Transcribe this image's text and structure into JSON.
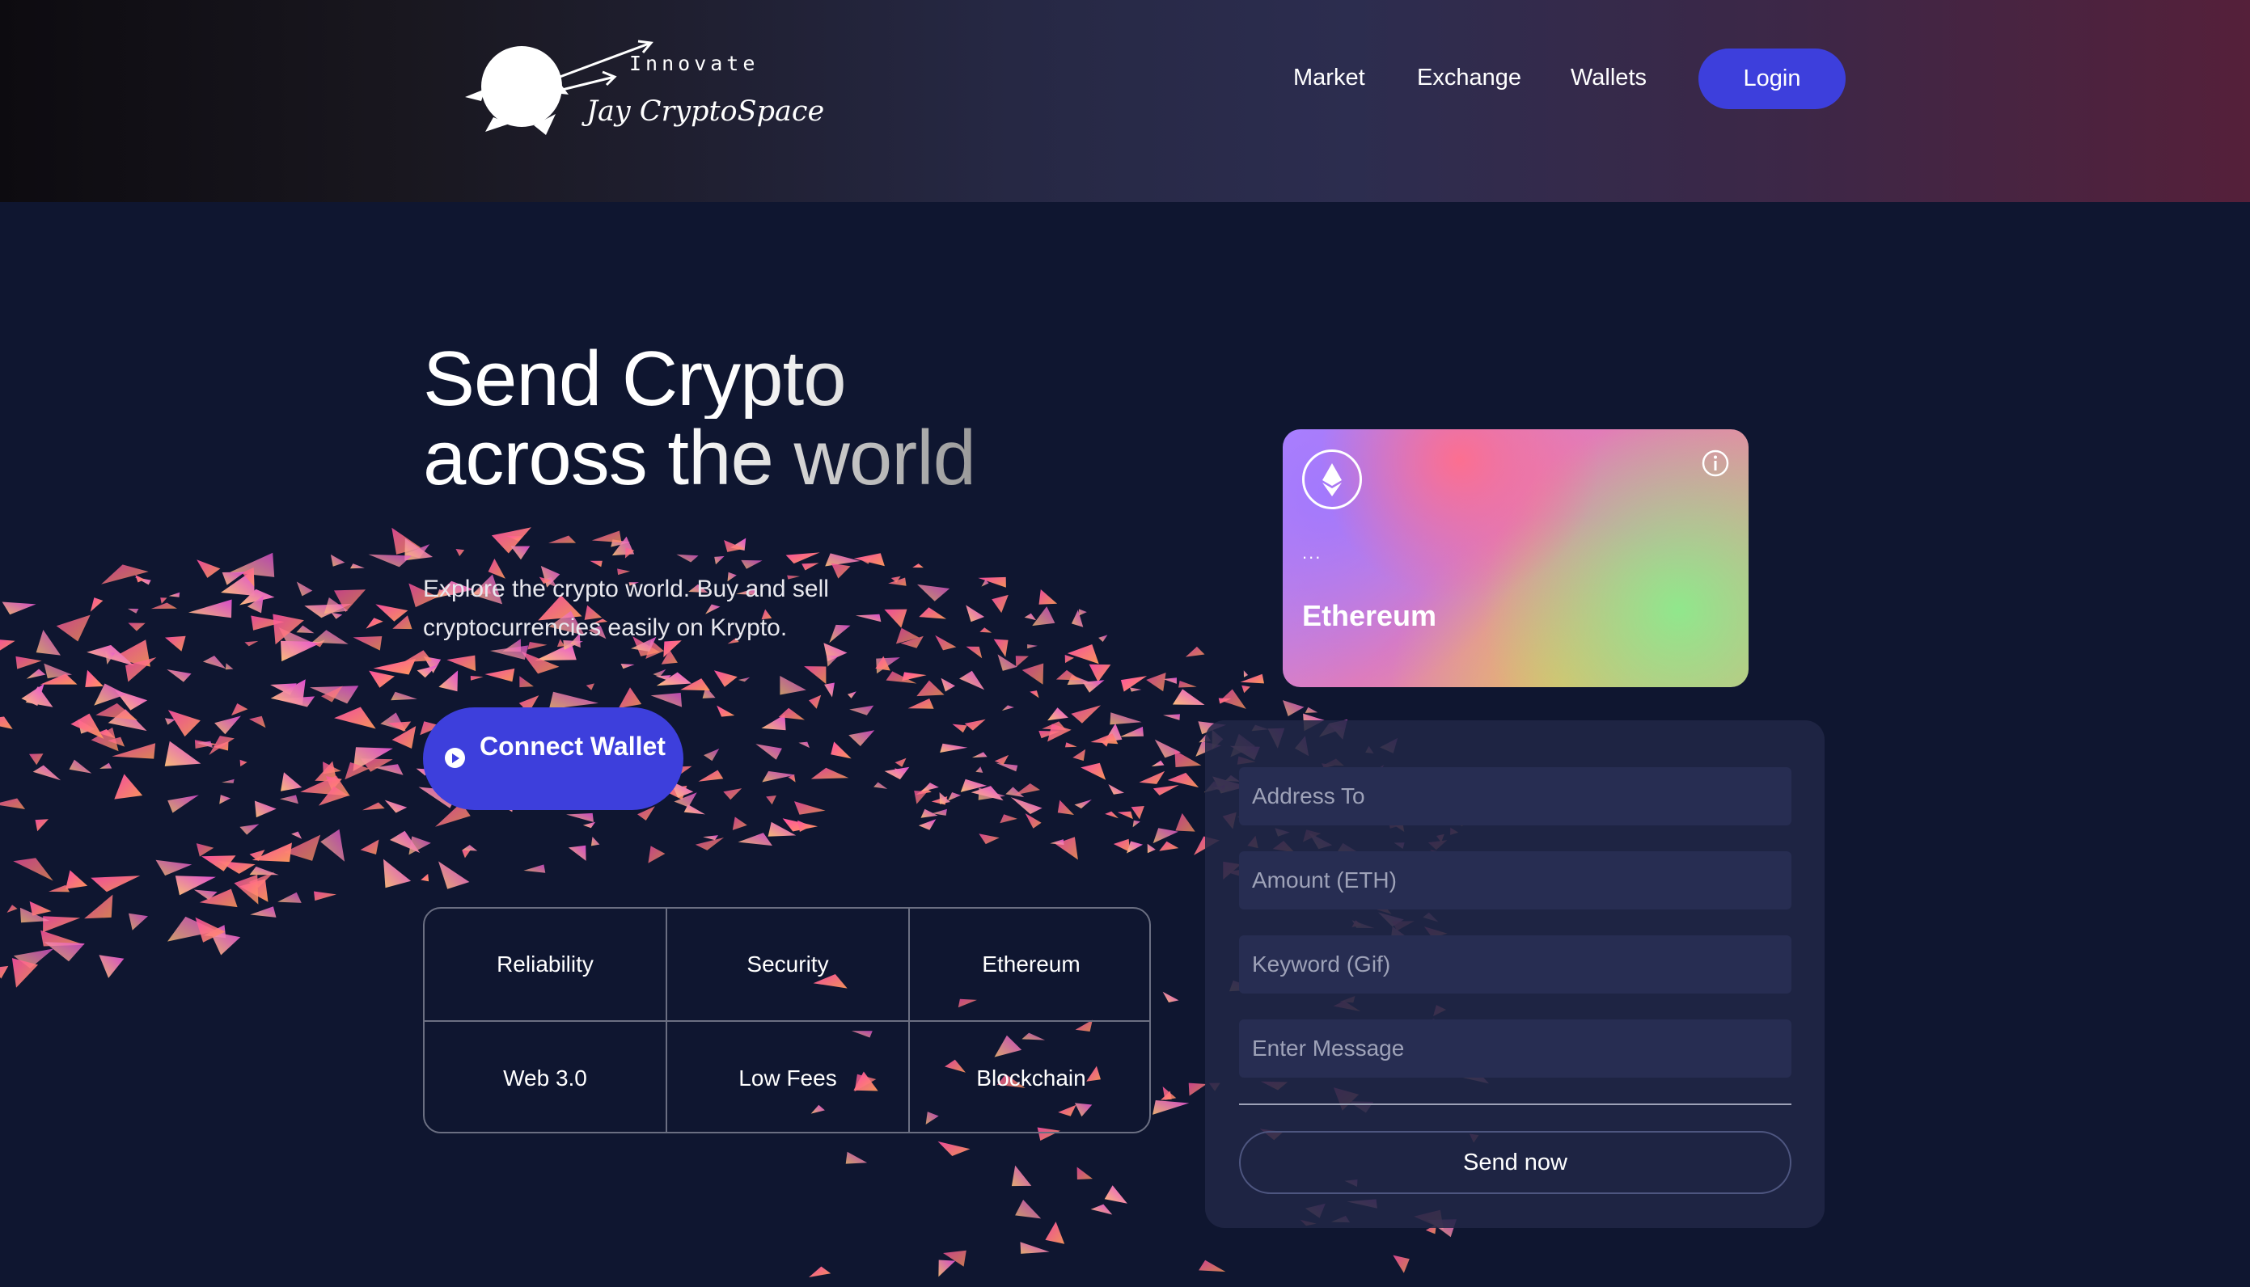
{
  "brand": {
    "tagline": "Innovate",
    "name": "Jay CryptoSpace"
  },
  "nav": {
    "items": [
      {
        "label": "Market"
      },
      {
        "label": "Exchange"
      },
      {
        "label": "Wallets"
      }
    ],
    "login_label": "Login"
  },
  "hero": {
    "title_line1": "Send Crypto",
    "title_line2": "across the world",
    "description": "Explore the crypto world. Buy and sell cryptocurrencies easily on Krypto.",
    "connect_label": "Connect Wallet"
  },
  "features": [
    "Reliability",
    "Security",
    "Ethereum",
    "Web 3.0",
    "Low Fees",
    "Blockchain"
  ],
  "card": {
    "address": "...",
    "network": "Ethereum",
    "icon": "ethereum-icon",
    "info_icon": "info-icon"
  },
  "form": {
    "address_placeholder": "Address To",
    "amount_placeholder": "Amount (ETH)",
    "keyword_placeholder": "Keyword (Gif)",
    "message_placeholder": "Enter Message",
    "submit_label": "Send now"
  },
  "colors": {
    "accent": "#3d3fdc",
    "background": "#0f1630",
    "panel": "#212746",
    "particle_pink": "#ff4fa3",
    "particle_orange": "#ff9a5c"
  }
}
